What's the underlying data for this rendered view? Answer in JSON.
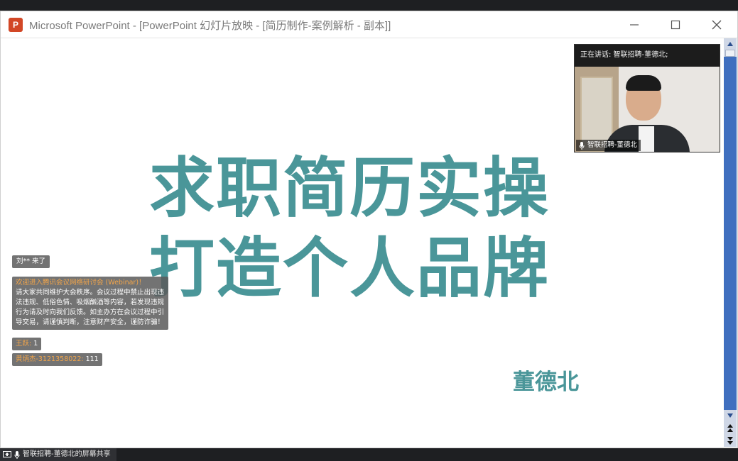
{
  "window": {
    "title": "Microsoft PowerPoint - [PowerPoint 幻灯片放映 - [简历制作-案例解析 - 副本]]",
    "app_icon_letter": "P"
  },
  "slide": {
    "line1": "求职简历实操",
    "line2": "打造个人品牌",
    "author": "董德北",
    "accent_color": "#4a9699"
  },
  "video": {
    "speaking_label": "正在讲话: 智联招聘-董德北;",
    "participant_name": "智联招聘-董德北"
  },
  "chat": {
    "join_notice": "刘** 来了",
    "welcome_title": "欢迎进入腾讯会议网络研讨会 (Webinar)！",
    "welcome_body": "请大家共同维护大会秩序。会议过程中禁止出现违法违规、低俗色情、吸烟酗酒等内容，若发现违规行为请及时向我们反馈。如主办方在会议过程中引导交易，请谨慎判断，注意财产安全，谨防诈骗！",
    "messages": [
      {
        "sender": "王跃:",
        "text": " 1"
      },
      {
        "sender": "黄炳杰-3121358022:",
        "text": " 111"
      }
    ]
  },
  "bottom": {
    "share_label": "智联招聘-董德北的屏幕共享"
  },
  "icons": [
    "powerpoint-icon",
    "minimize-icon",
    "maximize-icon",
    "close-icon",
    "scroll-up-icon",
    "scroll-down-icon",
    "page-up-icon",
    "page-down-icon",
    "microphone-icon",
    "screen-share-icon"
  ]
}
